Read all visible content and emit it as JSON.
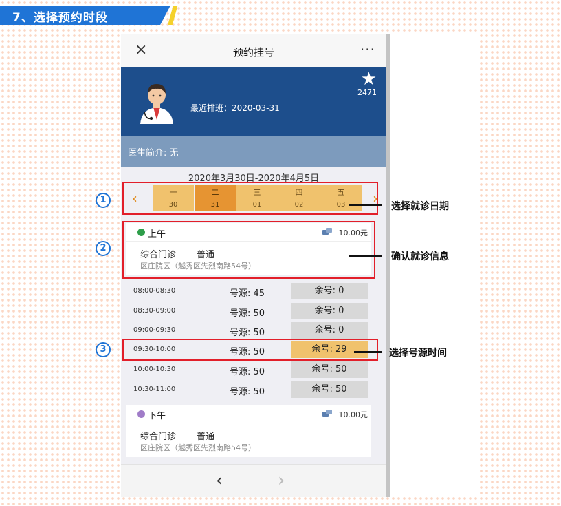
{
  "banner": {
    "title": "7、选择预约时段"
  },
  "nav": {
    "close_icon": "×",
    "title": "预约挂号",
    "more_icon": "···"
  },
  "doctor": {
    "latest_schedule": "最近排班：2020-03-31",
    "star_icon": "★",
    "star_count": "2471"
  },
  "intro": {
    "text": "医生简介: 无"
  },
  "week": {
    "range": "2020年3月30日-2020年4月5日",
    "prev_icon": "‹",
    "next_icon": "›",
    "days": [
      {
        "name": "一",
        "num": "30"
      },
      {
        "name": "二",
        "num": "31"
      },
      {
        "name": "三",
        "num": "01"
      },
      {
        "name": "四",
        "num": "02"
      },
      {
        "name": "五",
        "num": "03"
      }
    ],
    "selected_index": 1
  },
  "morning": {
    "label": "上午",
    "fee": "10.00元",
    "dept": "综合门诊",
    "level": "普通",
    "address": "区庄院区（越秀区先烈南路54号）"
  },
  "slots": [
    {
      "time": "08:00-08:30",
      "total": "号源: 45",
      "remain": "余号: 0",
      "available": false
    },
    {
      "time": "08:30-09:00",
      "total": "号源: 50",
      "remain": "余号: 0",
      "available": false
    },
    {
      "time": "09:00-09:30",
      "total": "号源: 50",
      "remain": "余号: 0",
      "available": false
    },
    {
      "time": "09:30-10:00",
      "total": "号源: 50",
      "remain": "余号: 29",
      "available": true
    },
    {
      "time": "10:00-10:30",
      "total": "号源: 50",
      "remain": "余号: 50",
      "available": false
    },
    {
      "time": "10:30-11:00",
      "total": "号源: 50",
      "remain": "余号: 50",
      "available": false
    }
  ],
  "afternoon": {
    "label": "下午",
    "fee": "10.00元",
    "dept": "综合门诊",
    "level": "普通",
    "address": "区庄院区（越秀区先烈南路54号）"
  },
  "pager": {
    "prev_icon": "‹",
    "next_icon": "›"
  },
  "annotations": [
    {
      "num": "1",
      "text": "选择就诊日期"
    },
    {
      "num": "2",
      "text": "确认就诊信息"
    },
    {
      "num": "3",
      "text": "选择号源时间"
    }
  ],
  "colors": {
    "banner": "#1f74d6",
    "header": "#1d4e8c",
    "intro": "#7d9bbd",
    "day": "#f0c26d",
    "day_selected": "#e69432",
    "highlight": "#e21f2a"
  }
}
